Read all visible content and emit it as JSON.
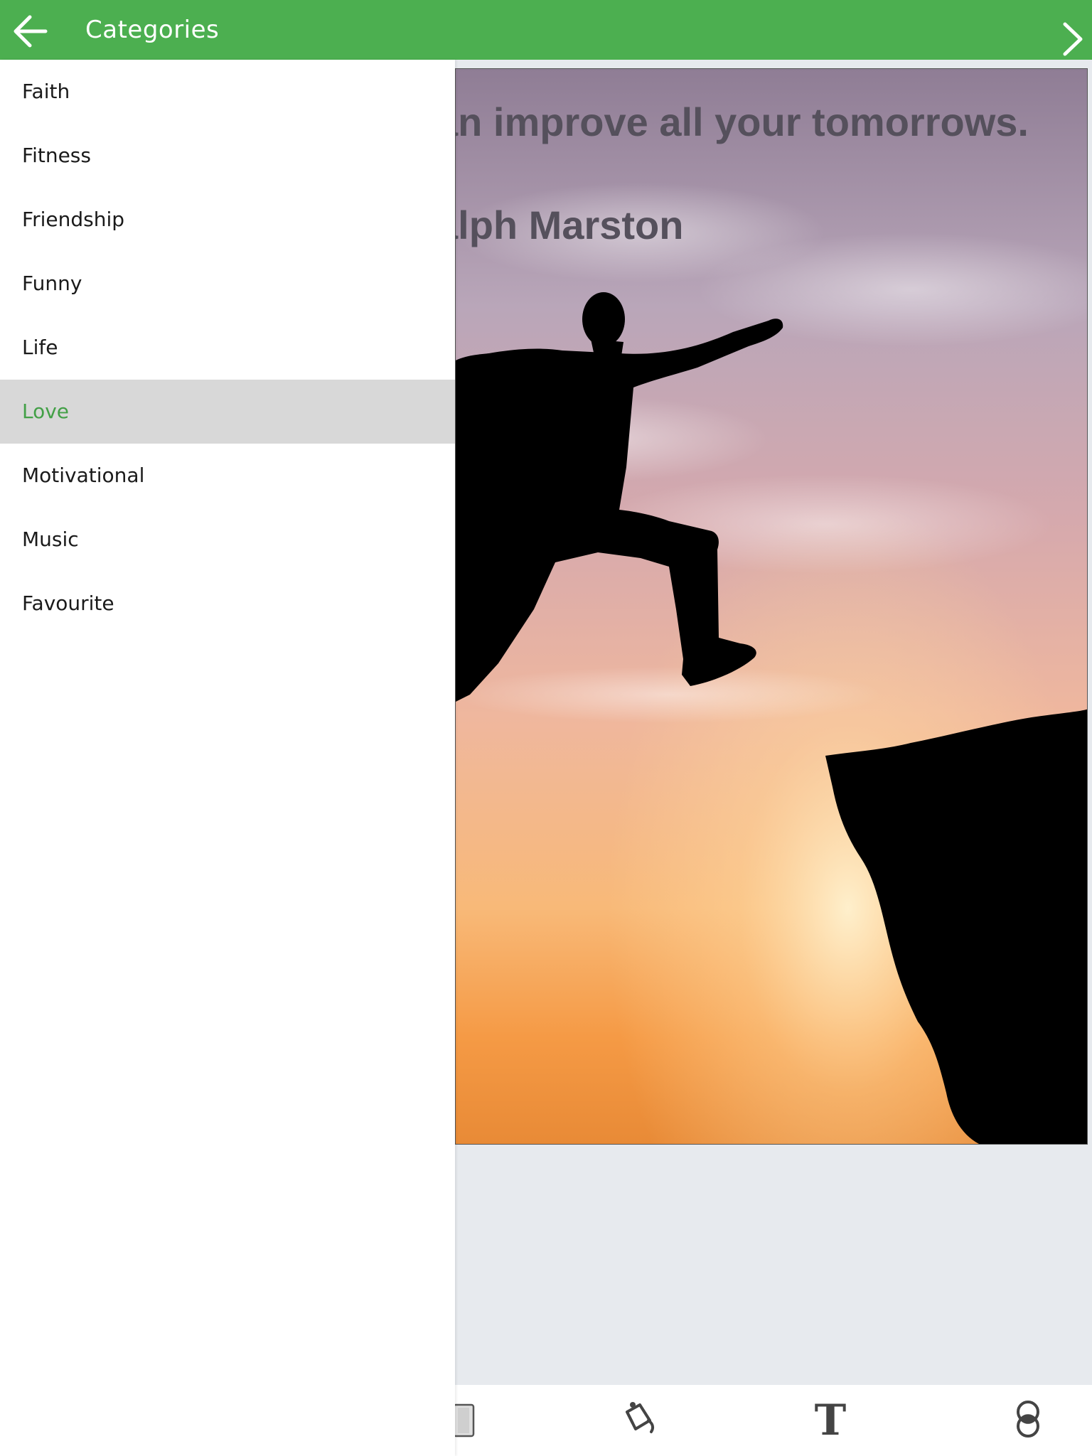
{
  "appbar": {
    "title": "Categories",
    "back_icon": "arrow-left-icon",
    "next_icon": "chevron-right-icon",
    "color": "#4caf50"
  },
  "drawer": {
    "items": [
      {
        "label": "Faith",
        "selected": false
      },
      {
        "label": "Fitness",
        "selected": false
      },
      {
        "label": "Friendship",
        "selected": false
      },
      {
        "label": "Funny",
        "selected": false
      },
      {
        "label": "Life",
        "selected": false
      },
      {
        "label": "Love",
        "selected": true
      },
      {
        "label": "Motivational",
        "selected": false
      },
      {
        "label": "Music",
        "selected": false
      },
      {
        "label": "Favourite",
        "selected": false
      }
    ],
    "selected_color": "#43a047"
  },
  "quote_card": {
    "line1": "an improve all your tomorrows.",
    "line2": "alph Marston"
  },
  "toolbar": {
    "icons": [
      "phone-frame-icon",
      "paint-bucket-icon",
      "text-icon",
      "filter-icon"
    ],
    "text_glyph": "T"
  }
}
